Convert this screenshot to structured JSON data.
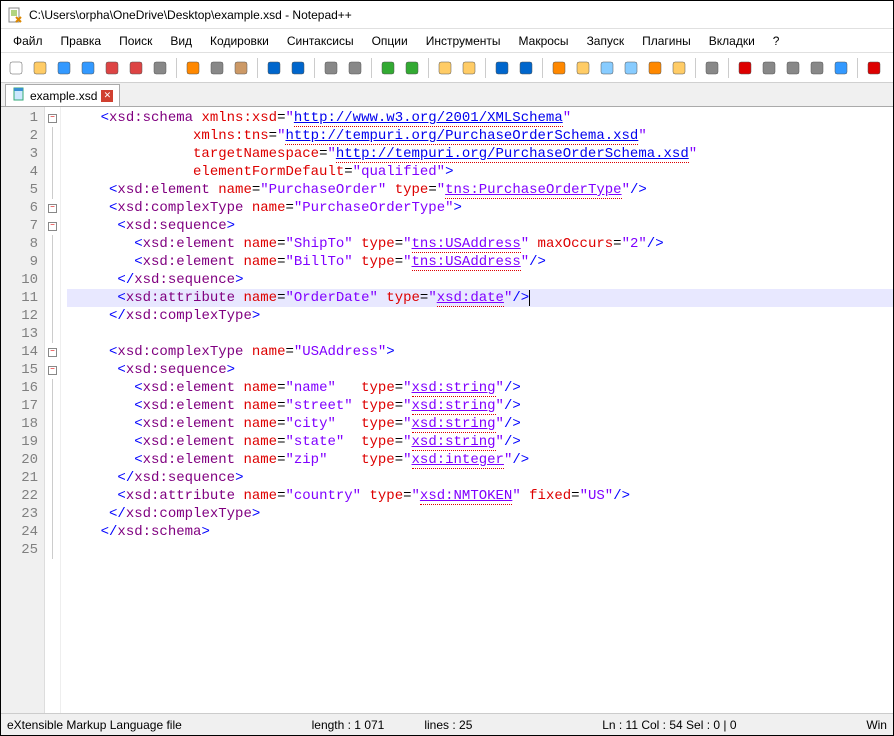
{
  "title": "C:\\Users\\orpha\\OneDrive\\Desktop\\example.xsd - Notepad++",
  "menu": [
    "Файл",
    "Правка",
    "Поиск",
    "Вид",
    "Кодировки",
    "Синтаксисы",
    "Опции",
    "Инструменты",
    "Макросы",
    "Запуск",
    "Плагины",
    "Вкладки",
    "?"
  ],
  "tab": {
    "label": "example.xsd"
  },
  "status": {
    "lang": "eXtensible Markup Language file",
    "length": "length : 1 071",
    "lines": "lines : 25",
    "pos": "Ln : 11   Col : 54   Sel : 0 | 0",
    "enc": "Win"
  },
  "code": {
    "highlight_line": 11,
    "lines": [
      {
        "n": 1,
        "indent": "    ",
        "fold": "box-minus",
        "tokens": [
          {
            "t": "brkt",
            "v": "<"
          },
          {
            "t": "tag",
            "v": "xsd:schema"
          },
          {
            "t": "sp",
            "v": " "
          },
          {
            "t": "attr",
            "v": "xmlns:xsd"
          },
          {
            "t": "eq",
            "v": "="
          },
          {
            "t": "str",
            "v": "\""
          },
          {
            "t": "url",
            "v": "http://www.w3.org/2001/XMLSchema"
          },
          {
            "t": "str",
            "v": "\""
          }
        ]
      },
      {
        "n": 2,
        "indent": "               ",
        "tokens": [
          {
            "t": "attr",
            "v": "xmlns:tns"
          },
          {
            "t": "eq",
            "v": "="
          },
          {
            "t": "str",
            "v": "\""
          },
          {
            "t": "url",
            "v": "http://tempuri.org/PurchaseOrderSchema.xsd"
          },
          {
            "t": "str",
            "v": "\""
          }
        ]
      },
      {
        "n": 3,
        "indent": "               ",
        "tokens": [
          {
            "t": "attr",
            "v": "targetNamespace"
          },
          {
            "t": "eq",
            "v": "="
          },
          {
            "t": "str",
            "v": "\""
          },
          {
            "t": "url",
            "v": "http://tempuri.org/PurchaseOrderSchema.xsd"
          },
          {
            "t": "str",
            "v": "\""
          }
        ]
      },
      {
        "n": 4,
        "indent": "               ",
        "tokens": [
          {
            "t": "attr",
            "v": "elementFormDefault"
          },
          {
            "t": "eq",
            "v": "="
          },
          {
            "t": "str",
            "v": "\"qualified\""
          },
          {
            "t": "brkt",
            "v": ">"
          }
        ]
      },
      {
        "n": 5,
        "indent": "     ",
        "tokens": [
          {
            "t": "brkt",
            "v": "<"
          },
          {
            "t": "tag",
            "v": "xsd:element"
          },
          {
            "t": "sp",
            "v": " "
          },
          {
            "t": "attr",
            "v": "name"
          },
          {
            "t": "eq",
            "v": "="
          },
          {
            "t": "str",
            "v": "\"PurchaseOrder\""
          },
          {
            "t": "sp",
            "v": " "
          },
          {
            "t": "attr",
            "v": "type"
          },
          {
            "t": "eq",
            "v": "="
          },
          {
            "t": "str",
            "v": "\""
          },
          {
            "t": "urlp",
            "v": "tns:PurchaseOrderType"
          },
          {
            "t": "str",
            "v": "\""
          },
          {
            "t": "brkt",
            "v": "/>"
          }
        ]
      },
      {
        "n": 6,
        "indent": "     ",
        "fold": "box-minus",
        "tokens": [
          {
            "t": "brkt",
            "v": "<"
          },
          {
            "t": "tag",
            "v": "xsd:complexType"
          },
          {
            "t": "sp",
            "v": " "
          },
          {
            "t": "attr",
            "v": "name"
          },
          {
            "t": "eq",
            "v": "="
          },
          {
            "t": "str",
            "v": "\"PurchaseOrderType\""
          },
          {
            "t": "brkt",
            "v": ">"
          }
        ]
      },
      {
        "n": 7,
        "indent": "      ",
        "fold": "box-minus",
        "tokens": [
          {
            "t": "brkt",
            "v": "<"
          },
          {
            "t": "tag",
            "v": "xsd:sequence"
          },
          {
            "t": "brkt",
            "v": ">"
          }
        ]
      },
      {
        "n": 8,
        "indent": "        ",
        "tokens": [
          {
            "t": "brkt",
            "v": "<"
          },
          {
            "t": "tag",
            "v": "xsd:element"
          },
          {
            "t": "sp",
            "v": " "
          },
          {
            "t": "attr",
            "v": "name"
          },
          {
            "t": "eq",
            "v": "="
          },
          {
            "t": "str",
            "v": "\"ShipTo\""
          },
          {
            "t": "sp",
            "v": " "
          },
          {
            "t": "attr",
            "v": "type"
          },
          {
            "t": "eq",
            "v": "="
          },
          {
            "t": "str",
            "v": "\""
          },
          {
            "t": "urlp",
            "v": "tns:USAddress"
          },
          {
            "t": "str",
            "v": "\""
          },
          {
            "t": "sp",
            "v": " "
          },
          {
            "t": "attr",
            "v": "maxOccurs"
          },
          {
            "t": "eq",
            "v": "="
          },
          {
            "t": "str",
            "v": "\"2\""
          },
          {
            "t": "brkt",
            "v": "/>"
          }
        ]
      },
      {
        "n": 9,
        "indent": "        ",
        "tokens": [
          {
            "t": "brkt",
            "v": "<"
          },
          {
            "t": "tag",
            "v": "xsd:element"
          },
          {
            "t": "sp",
            "v": " "
          },
          {
            "t": "attr",
            "v": "name"
          },
          {
            "t": "eq",
            "v": "="
          },
          {
            "t": "str",
            "v": "\"BillTo\""
          },
          {
            "t": "sp",
            "v": " "
          },
          {
            "t": "attr",
            "v": "type"
          },
          {
            "t": "eq",
            "v": "="
          },
          {
            "t": "str",
            "v": "\""
          },
          {
            "t": "urlp",
            "v": "tns:USAddress"
          },
          {
            "t": "str",
            "v": "\""
          },
          {
            "t": "brkt",
            "v": "/>"
          }
        ]
      },
      {
        "n": 10,
        "indent": "      ",
        "tokens": [
          {
            "t": "brkt",
            "v": "</"
          },
          {
            "t": "tag",
            "v": "xsd:sequence"
          },
          {
            "t": "brkt",
            "v": ">"
          }
        ]
      },
      {
        "n": 11,
        "indent": "      ",
        "tokens": [
          {
            "t": "brkt",
            "v": "<"
          },
          {
            "t": "tag",
            "v": "xsd:attribute"
          },
          {
            "t": "sp",
            "v": " "
          },
          {
            "t": "attr",
            "v": "name"
          },
          {
            "t": "eq",
            "v": "="
          },
          {
            "t": "str",
            "v": "\"OrderDate\""
          },
          {
            "t": "sp",
            "v": " "
          },
          {
            "t": "attr",
            "v": "type"
          },
          {
            "t": "eq",
            "v": "="
          },
          {
            "t": "str",
            "v": "\""
          },
          {
            "t": "urlp",
            "v": "xsd:date"
          },
          {
            "t": "str",
            "v": "\""
          },
          {
            "t": "brkt",
            "v": "/>"
          },
          {
            "t": "caret",
            "v": "  "
          }
        ]
      },
      {
        "n": 12,
        "indent": "     ",
        "tokens": [
          {
            "t": "brkt",
            "v": "</"
          },
          {
            "t": "tag",
            "v": "xsd:complexType"
          },
          {
            "t": "brkt",
            "v": ">"
          }
        ]
      },
      {
        "n": 13,
        "indent": "",
        "tokens": []
      },
      {
        "n": 14,
        "indent": "     ",
        "fold": "box-minus",
        "tokens": [
          {
            "t": "brkt",
            "v": "<"
          },
          {
            "t": "tag",
            "v": "xsd:complexType"
          },
          {
            "t": "sp",
            "v": " "
          },
          {
            "t": "attr",
            "v": "name"
          },
          {
            "t": "eq",
            "v": "="
          },
          {
            "t": "str",
            "v": "\"USAddress\""
          },
          {
            "t": "brkt",
            "v": ">"
          }
        ]
      },
      {
        "n": 15,
        "indent": "      ",
        "fold": "box-minus",
        "tokens": [
          {
            "t": "brkt",
            "v": "<"
          },
          {
            "t": "tag",
            "v": "xsd:sequence"
          },
          {
            "t": "brkt",
            "v": ">"
          }
        ]
      },
      {
        "n": 16,
        "indent": "        ",
        "tokens": [
          {
            "t": "brkt",
            "v": "<"
          },
          {
            "t": "tag",
            "v": "xsd:element"
          },
          {
            "t": "sp",
            "v": " "
          },
          {
            "t": "attr",
            "v": "name"
          },
          {
            "t": "eq",
            "v": "="
          },
          {
            "t": "str",
            "v": "\"name\""
          },
          {
            "t": "sp",
            "v": "   "
          },
          {
            "t": "attr",
            "v": "type"
          },
          {
            "t": "eq",
            "v": "="
          },
          {
            "t": "str",
            "v": "\""
          },
          {
            "t": "urlp",
            "v": "xsd:string"
          },
          {
            "t": "str",
            "v": "\""
          },
          {
            "t": "brkt",
            "v": "/>"
          }
        ]
      },
      {
        "n": 17,
        "indent": "        ",
        "tokens": [
          {
            "t": "brkt",
            "v": "<"
          },
          {
            "t": "tag",
            "v": "xsd:element"
          },
          {
            "t": "sp",
            "v": " "
          },
          {
            "t": "attr",
            "v": "name"
          },
          {
            "t": "eq",
            "v": "="
          },
          {
            "t": "str",
            "v": "\"street\""
          },
          {
            "t": "sp",
            "v": " "
          },
          {
            "t": "attr",
            "v": "type"
          },
          {
            "t": "eq",
            "v": "="
          },
          {
            "t": "str",
            "v": "\""
          },
          {
            "t": "urlp",
            "v": "xsd:string"
          },
          {
            "t": "str",
            "v": "\""
          },
          {
            "t": "brkt",
            "v": "/>"
          }
        ]
      },
      {
        "n": 18,
        "indent": "        ",
        "tokens": [
          {
            "t": "brkt",
            "v": "<"
          },
          {
            "t": "tag",
            "v": "xsd:element"
          },
          {
            "t": "sp",
            "v": " "
          },
          {
            "t": "attr",
            "v": "name"
          },
          {
            "t": "eq",
            "v": "="
          },
          {
            "t": "str",
            "v": "\"city\""
          },
          {
            "t": "sp",
            "v": "   "
          },
          {
            "t": "attr",
            "v": "type"
          },
          {
            "t": "eq",
            "v": "="
          },
          {
            "t": "str",
            "v": "\""
          },
          {
            "t": "urlp",
            "v": "xsd:string"
          },
          {
            "t": "str",
            "v": "\""
          },
          {
            "t": "brkt",
            "v": "/>"
          }
        ]
      },
      {
        "n": 19,
        "indent": "        ",
        "tokens": [
          {
            "t": "brkt",
            "v": "<"
          },
          {
            "t": "tag",
            "v": "xsd:element"
          },
          {
            "t": "sp",
            "v": " "
          },
          {
            "t": "attr",
            "v": "name"
          },
          {
            "t": "eq",
            "v": "="
          },
          {
            "t": "str",
            "v": "\"state\""
          },
          {
            "t": "sp",
            "v": "  "
          },
          {
            "t": "attr",
            "v": "type"
          },
          {
            "t": "eq",
            "v": "="
          },
          {
            "t": "str",
            "v": "\""
          },
          {
            "t": "urlp",
            "v": "xsd:string"
          },
          {
            "t": "str",
            "v": "\""
          },
          {
            "t": "brkt",
            "v": "/>"
          }
        ]
      },
      {
        "n": 20,
        "indent": "        ",
        "tokens": [
          {
            "t": "brkt",
            "v": "<"
          },
          {
            "t": "tag",
            "v": "xsd:element"
          },
          {
            "t": "sp",
            "v": " "
          },
          {
            "t": "attr",
            "v": "name"
          },
          {
            "t": "eq",
            "v": "="
          },
          {
            "t": "str",
            "v": "\"zip\""
          },
          {
            "t": "sp",
            "v": "    "
          },
          {
            "t": "attr",
            "v": "type"
          },
          {
            "t": "eq",
            "v": "="
          },
          {
            "t": "str",
            "v": "\""
          },
          {
            "t": "urlp",
            "v": "xsd:integer"
          },
          {
            "t": "str",
            "v": "\""
          },
          {
            "t": "brkt",
            "v": "/>"
          }
        ]
      },
      {
        "n": 21,
        "indent": "      ",
        "tokens": [
          {
            "t": "brkt",
            "v": "</"
          },
          {
            "t": "tag",
            "v": "xsd:sequence"
          },
          {
            "t": "brkt",
            "v": ">"
          }
        ]
      },
      {
        "n": 22,
        "indent": "      ",
        "tokens": [
          {
            "t": "brkt",
            "v": "<"
          },
          {
            "t": "tag",
            "v": "xsd:attribute"
          },
          {
            "t": "sp",
            "v": " "
          },
          {
            "t": "attr",
            "v": "name"
          },
          {
            "t": "eq",
            "v": "="
          },
          {
            "t": "str",
            "v": "\"country\""
          },
          {
            "t": "sp",
            "v": " "
          },
          {
            "t": "attr",
            "v": "type"
          },
          {
            "t": "eq",
            "v": "="
          },
          {
            "t": "str",
            "v": "\""
          },
          {
            "t": "urlp",
            "v": "xsd:NMTOKEN"
          },
          {
            "t": "str",
            "v": "\""
          },
          {
            "t": "sp",
            "v": " "
          },
          {
            "t": "attr",
            "v": "fixed"
          },
          {
            "t": "eq",
            "v": "="
          },
          {
            "t": "str",
            "v": "\"US\""
          },
          {
            "t": "brkt",
            "v": "/>"
          }
        ]
      },
      {
        "n": 23,
        "indent": "     ",
        "tokens": [
          {
            "t": "brkt",
            "v": "</"
          },
          {
            "t": "tag",
            "v": "xsd:complexType"
          },
          {
            "t": "brkt",
            "v": ">"
          }
        ]
      },
      {
        "n": 24,
        "indent": "    ",
        "tokens": [
          {
            "t": "brkt",
            "v": "</"
          },
          {
            "t": "tag",
            "v": "xsd:schema"
          },
          {
            "t": "brkt",
            "v": ">"
          }
        ]
      },
      {
        "n": 25,
        "indent": "",
        "tokens": []
      }
    ]
  },
  "toolbar_icons": [
    "new-file-icon",
    "open-file-icon",
    "save-icon",
    "save-all-icon",
    "close-icon",
    "close-all-icon",
    "print-icon",
    "sep",
    "cut-icon",
    "copy-icon",
    "paste-icon",
    "sep",
    "undo-icon",
    "redo-icon",
    "sep",
    "find-icon",
    "replace-icon",
    "sep",
    "zoom-in-icon",
    "zoom-out-icon",
    "sep",
    "sync-v-icon",
    "sync-h-icon",
    "sep",
    "wordwrap-icon",
    "show-all-icon",
    "sep",
    "indent-guide-icon",
    "lang-icon",
    "doc-map-icon",
    "doc-list-icon",
    "func-list-icon",
    "folder-icon",
    "sep",
    "monitor-icon",
    "sep",
    "record-icon",
    "stop-icon",
    "play-icon",
    "play-multi-icon",
    "save-macro-icon",
    "sep",
    "spellcheck-icon"
  ]
}
